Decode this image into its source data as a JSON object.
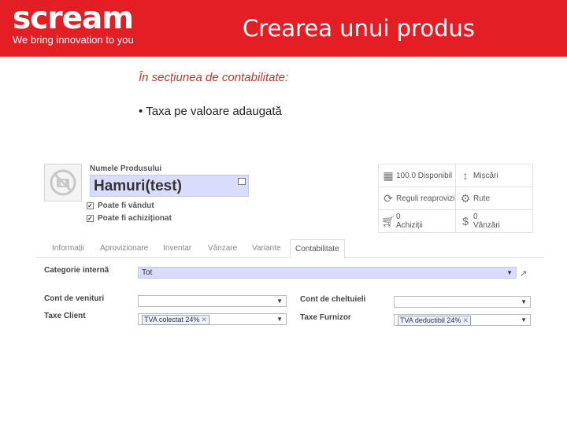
{
  "header": {
    "logo_word": "scream",
    "logo_tagline": "We bring innovation to you",
    "title": "Crearea unui produs"
  },
  "colors": {
    "brand": "#e31e24",
    "subtitle": "#c0392b",
    "highlight": "#d9dcfb"
  },
  "body": {
    "subtitle": "În secțiunea de contabilitate:",
    "bullet": "Taxa pe valoare adaugată"
  },
  "form": {
    "product_label": "Numele Produsului",
    "product_name": "Hamuri(test)",
    "can_be_sold": "Poate fi vândut",
    "can_be_purchased": "Poate fi achiziționat",
    "stats": [
      {
        "icon": "building-icon",
        "line1": "100.0 Disponibil",
        "line2": ""
      },
      {
        "icon": "arrows-vertical-icon",
        "line1": "Mișcări",
        "line2": ""
      },
      {
        "icon": "refresh-icon",
        "line1": "Reguli reaprovizio",
        "line2": ""
      },
      {
        "icon": "gears-icon",
        "line1": "Rute",
        "line2": ""
      },
      {
        "icon": "cart-icon",
        "line1": "0",
        "line2": "Achiziții"
      },
      {
        "icon": "dollar-icon",
        "line1": "0",
        "line2": "Vânzări"
      }
    ],
    "tabs": [
      "Informații",
      "Aprovizionare",
      "Inventar",
      "Vânzare",
      "Variante",
      "Contabilitate"
    ],
    "internal_category_label": "Categorie internă",
    "internal_category_value": "Tot",
    "income_account_label": "Cont de venituri",
    "expense_account_label": "Cont de cheltuieli",
    "customer_taxes_label": "Taxe Client",
    "customer_tax_tag": "TVA colectat 24%",
    "supplier_taxes_label": "Taxe Furnizor",
    "supplier_tax_tag": "TVA deductibil 24%"
  }
}
